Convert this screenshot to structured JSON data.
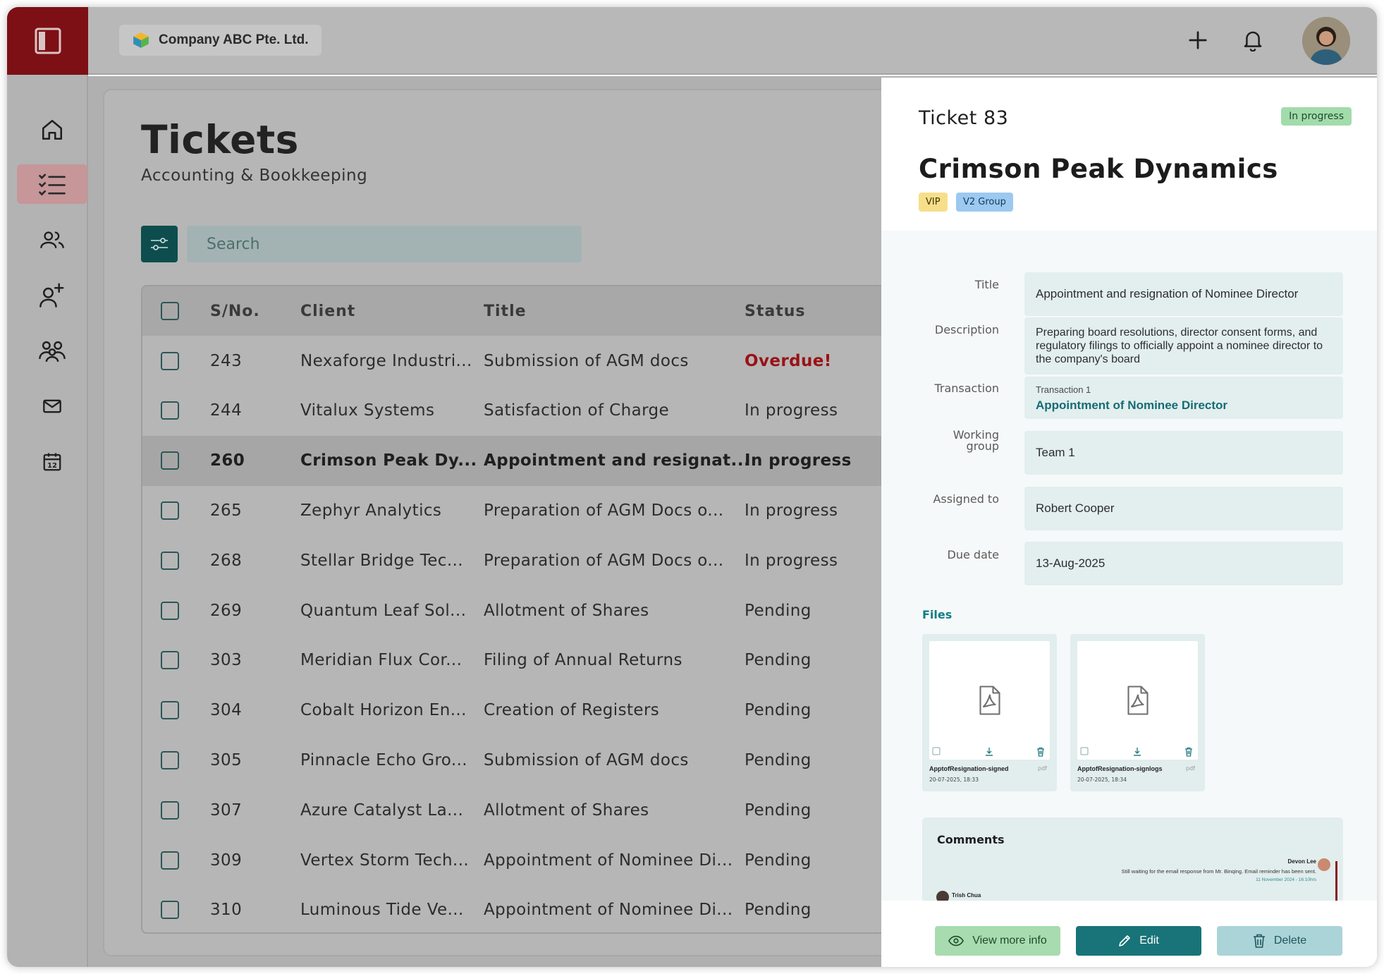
{
  "company": {
    "name": "Company ABC Pte. Ltd."
  },
  "header": {
    "add_icon": "plus-icon",
    "notification_icon": "bell-icon"
  },
  "sidebar": {
    "items": [
      {
        "name": "home",
        "icon": "home-icon"
      },
      {
        "name": "tickets",
        "icon": "checklist-icon",
        "active": true
      },
      {
        "name": "contacts",
        "icon": "users-icon"
      },
      {
        "name": "add-user",
        "icon": "user-plus-icon"
      },
      {
        "name": "groups",
        "icon": "group-icon"
      },
      {
        "name": "mail",
        "icon": "mail-icon"
      },
      {
        "name": "calendar",
        "icon": "calendar-icon",
        "day": "12"
      }
    ]
  },
  "page": {
    "title": "Tickets",
    "subtitle": "Accounting & Bookkeeping",
    "search_placeholder": "Search"
  },
  "table": {
    "columns": [
      "S/No.",
      "Client",
      "Title",
      "Status"
    ],
    "rows": [
      {
        "sno": "243",
        "client": "Nexaforge Industri...",
        "title": "Submission of  AGM docs",
        "status": "Overdue!"
      },
      {
        "sno": "244",
        "client": "Vitalux Systems",
        "title": "Satisfaction of Charge",
        "status": "In progress"
      },
      {
        "sno": "260",
        "client": "Crimson Peak Dy...",
        "title": "Appointment and resignat...",
        "status": "In progress"
      },
      {
        "sno": "265",
        "client": "Zephyr Analytics",
        "title": "Preparation of AGM Docs o...",
        "status": "In progress"
      },
      {
        "sno": "268",
        "client": "Stellar Bridge Tec...",
        "title": "Preparation of AGM Docs o...",
        "status": "In progress"
      },
      {
        "sno": "269",
        "client": "Quantum Leaf Sol...",
        "title": "Allotment of Shares",
        "status": "Pending"
      },
      {
        "sno": "303",
        "client": "Meridian Flux Cor...",
        "title": "Filing of Annual Returns",
        "status": "Pending"
      },
      {
        "sno": "304",
        "client": "Cobalt Horizon En...",
        "title": "Creation of Registers",
        "status": "Pending"
      },
      {
        "sno": "305",
        "client": "Pinnacle Echo Gro...",
        "title": "Submission of  AGM docs",
        "status": "Pending"
      },
      {
        "sno": "307",
        "client": "Azure Catalyst La...",
        "title": "Allotment of Shares",
        "status": "Pending"
      },
      {
        "sno": "309",
        "client": "Vertex Storm Tech...",
        "title": "Appointment of Nominee Di...",
        "status": "Pending"
      },
      {
        "sno": "310",
        "client": "Luminous Tide Ve...",
        "title": "Appointment of Nominee Di...",
        "status": "Pending"
      }
    ]
  },
  "detail": {
    "ticket": "Ticket 83",
    "status": "In progress",
    "company": "Crimson Peak Dynamics",
    "tags": [
      "VIP",
      "V2 Group"
    ],
    "fields": {
      "title_label": "Title",
      "title_value": "Appointment and resignation of Nominee Director",
      "description_label": "Description",
      "description_value": "Preparing board resolutions, director consent forms, and regulatory filings to officially appoint a nominee director to the company's board",
      "transaction_label": "Transaction",
      "transaction_small": "Transaction 1",
      "transaction_value": "Appointment of Nominee Director",
      "working_group_label_1": "Working",
      "working_group_label_2": "group",
      "working_group_value": "Team 1",
      "assigned_label": "Assigned to",
      "assigned_value": "Robert Cooper",
      "due_label": "Due date",
      "due_value": "13-Aug-2025"
    },
    "files_label": "Files",
    "files": [
      {
        "name": "ApptofResignation-signed",
        "ext": "pdf",
        "date": "20-07-2025, 18:33"
      },
      {
        "name": "ApptofResignation-signlogs",
        "ext": "pdf",
        "date": "20-07-2025, 18:34"
      }
    ],
    "comments": {
      "title": "Comments",
      "items": [
        {
          "author": "Devon Lee",
          "text": "Still waiting for the email response from Mr. Binqing. Email reminder has been sent.",
          "time": "11 November 2024 - 16:10hrs"
        },
        {
          "author": "Trish Chua"
        }
      ]
    },
    "buttons": {
      "view": "View more info",
      "edit": "Edit",
      "delete": "Delete"
    }
  },
  "colors": {
    "brand": "#7d1014",
    "accent": "#187478",
    "overdue": "#9a1216"
  }
}
